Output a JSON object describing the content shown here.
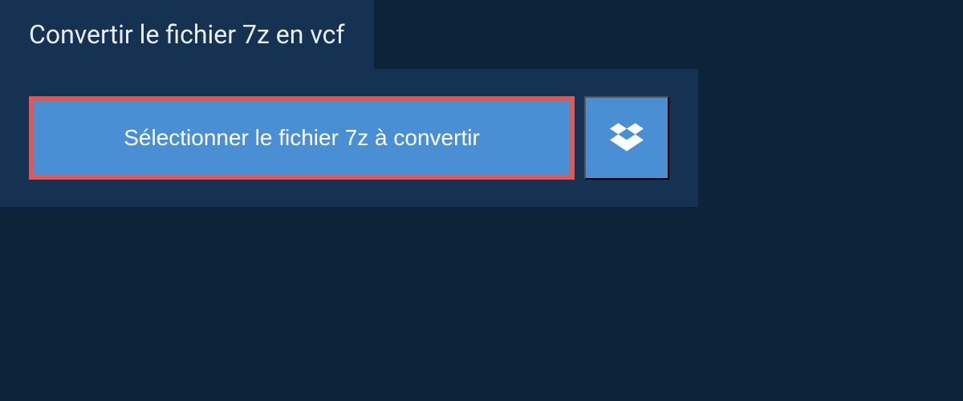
{
  "header": {
    "title": "Convertir le fichier 7z en vcf"
  },
  "actions": {
    "select_file_label": "Sélectionner le fichier 7z à convertir",
    "dropbox_icon": "dropbox"
  },
  "colors": {
    "background": "#0d2438",
    "panel": "#163252",
    "button_primary": "#4a8fd4",
    "button_highlight_border": "#d85a5a",
    "text_light": "#e8eef4"
  }
}
